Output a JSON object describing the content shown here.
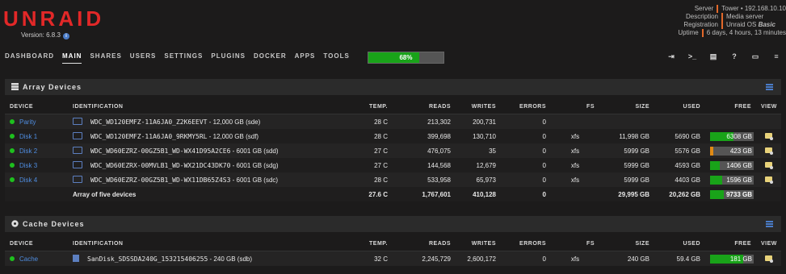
{
  "header": {
    "logo": "UNRAID",
    "version": "Version: 6.8.3",
    "info_icon": "info-icon",
    "server_info": [
      {
        "key": "Server",
        "value": "Tower • 192.168.10.10"
      },
      {
        "key": "Description",
        "value": "Media server"
      },
      {
        "key": "Registration",
        "value_prefix": "Unraid OS ",
        "value_bold": "Basic"
      },
      {
        "key": "Uptime",
        "value": "6 days, 4 hours, 13 minutes"
      }
    ]
  },
  "nav": {
    "items": [
      "DASHBOARD",
      "MAIN",
      "SHARES",
      "USERS",
      "SETTINGS",
      "PLUGINS",
      "DOCKER",
      "APPS",
      "TOOLS"
    ],
    "active": "MAIN",
    "utilization": {
      "label": "68%",
      "value": 0.68
    },
    "tools": [
      "logout-icon",
      "terminal-icon",
      "feedback-icon",
      "help-icon",
      "info-screen-icon",
      "menu-icon"
    ]
  },
  "array": {
    "title": "Array Devices",
    "icon": "array-icon",
    "columns": [
      "DEVICE",
      "IDENTIFICATION",
      "TEMP.",
      "READS",
      "WRITES",
      "ERRORS",
      "FS",
      "SIZE",
      "USED",
      "FREE",
      "VIEW"
    ],
    "rows": [
      {
        "device": "Parity",
        "id": "WDC_WD120EMFZ-11A6JA0_Z2K6EEVT",
        "meta": " - 12,000 GB (sde)",
        "temp": "28 C",
        "reads": "213,302",
        "writes": "200,731",
        "errors": "0",
        "fs": "",
        "size": "",
        "used": "",
        "free": "",
        "free_fraction": null
      },
      {
        "device": "Disk 1",
        "id": "WDC_WD120EMFZ-11A6JA0_9RKMY5RL",
        "meta": " - 12,000 GB (sdf)",
        "temp": "28 C",
        "reads": "399,698",
        "writes": "130,710",
        "errors": "0",
        "fs": "xfs",
        "size": "11,998 GB",
        "used": "5690 GB",
        "free": "6308 GB",
        "free_fraction": 0.53,
        "bar_color": "#19a319"
      },
      {
        "device": "Disk 2",
        "id": "WDC_WD60EZRZ-00GZ5B1_WD-WX41D95A2CE6",
        "meta": " - 6001 GB (sdd)",
        "temp": "27 C",
        "reads": "476,075",
        "writes": "35",
        "errors": "0",
        "fs": "xfs",
        "size": "5999 GB",
        "used": "5576 GB",
        "free": "423 GB",
        "free_fraction": 0.07,
        "bar_color": "#e08a14"
      },
      {
        "device": "Disk 3",
        "id": "WDC_WD60EZRX-00MVLB1_WD-WX21DC43DK70",
        "meta": " - 6001 GB (sdg)",
        "temp": "27 C",
        "reads": "144,568",
        "writes": "12,679",
        "errors": "0",
        "fs": "xfs",
        "size": "5999 GB",
        "used": "4593 GB",
        "free": "1406 GB",
        "free_fraction": 0.23,
        "bar_color": "#19a319"
      },
      {
        "device": "Disk 4",
        "id": "WDC_WD60EZRZ-00GZ5B1_WD-WX11DB65Z4S3",
        "meta": " - 6001 GB (sdc)",
        "temp": "28 C",
        "reads": "533,958",
        "writes": "65,973",
        "errors": "0",
        "fs": "xfs",
        "size": "5999 GB",
        "used": "4403 GB",
        "free": "1596 GB",
        "free_fraction": 0.27,
        "bar_color": "#19a319"
      }
    ],
    "total": {
      "label": "Array of five devices",
      "temp": "27.6 C",
      "reads": "1,767,601",
      "writes": "410,128",
      "errors": "0",
      "size": "29,995 GB",
      "used": "20,262 GB",
      "free": "9733 GB",
      "free_fraction": 0.32
    }
  },
  "cache": {
    "title": "Cache Devices",
    "icon": "cache-icon",
    "columns": [
      "DEVICE",
      "IDENTIFICATION",
      "TEMP.",
      "READS",
      "WRITES",
      "ERRORS",
      "FS",
      "SIZE",
      "USED",
      "FREE",
      "VIEW"
    ],
    "rows": [
      {
        "device": "Cache",
        "id": "SanDisk_SDSSDA240G_153215406255",
        "meta": " - 240 GB (sdb)",
        "temp": "32 C",
        "reads": "2,245,729",
        "writes": "2,600,172",
        "errors": "0",
        "fs": "xfs",
        "size": "240 GB",
        "used": "59.4 GB",
        "free": "181 GB",
        "free_fraction": 0.75,
        "bar_color": "#19a319"
      }
    ]
  },
  "colors": {
    "accent": "#e22828",
    "link": "#4f8de0",
    "ok": "#1ec01e",
    "bar_green": "#19a319",
    "bar_orange": "#e08a14"
  }
}
